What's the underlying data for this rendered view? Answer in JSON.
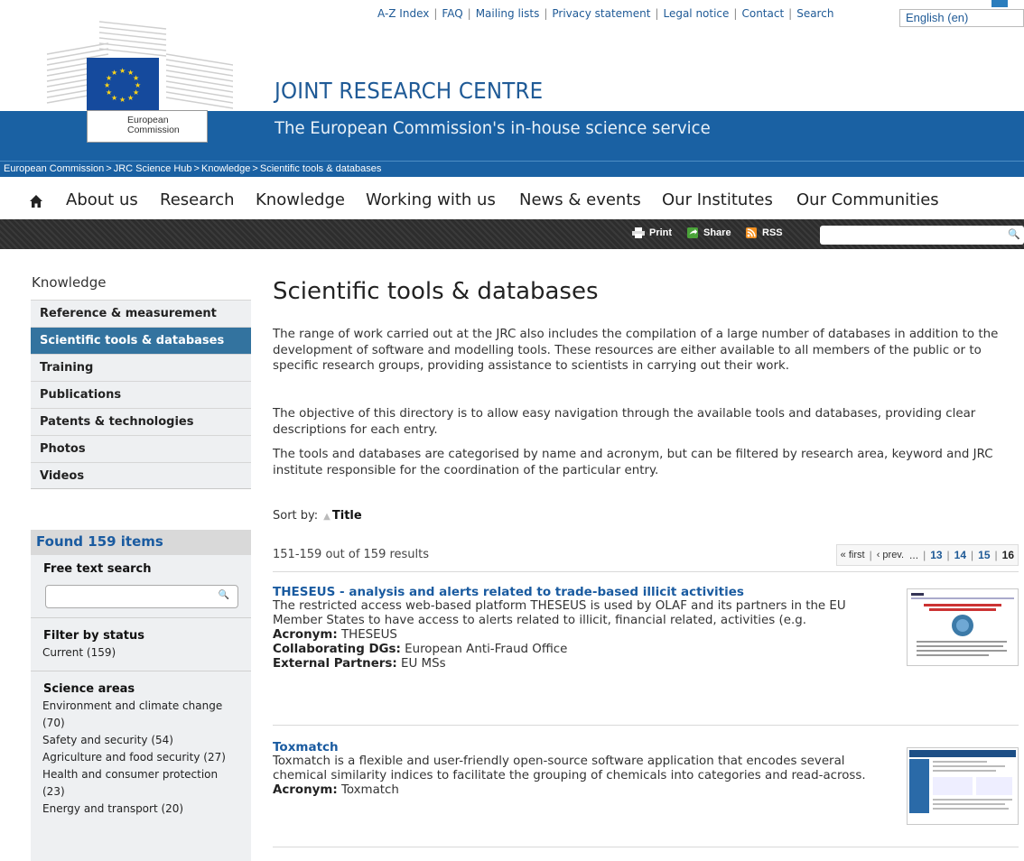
{
  "top_links": [
    "A-Z Index",
    "FAQ",
    "Mailing lists",
    "Privacy statement",
    "Legal notice",
    "Contact",
    "Search"
  ],
  "language": "English (en)",
  "header": {
    "logo_text_line1": "European",
    "logo_text_line2": "Commission",
    "title": "JOINT RESEARCH CENTRE",
    "subtitle": "The European Commission's in-house science service"
  },
  "breadcrumb": [
    "European Commission",
    "JRC Science Hub",
    "Knowledge",
    "Scientific tools & databases"
  ],
  "nav": [
    "About us",
    "Research",
    "Knowledge",
    "Working with us",
    "News & events",
    "Our Institutes",
    "Our Communities"
  ],
  "toolbar": {
    "print": "Print",
    "share": "Share",
    "rss": "RSS"
  },
  "sidebar": {
    "heading": "Knowledge",
    "items": [
      {
        "label": "Reference & measurement"
      },
      {
        "label": "Scientific tools & databases",
        "active": true
      },
      {
        "label": "Training"
      },
      {
        "label": "Publications"
      },
      {
        "label": "Patents & technologies"
      },
      {
        "label": "Photos"
      },
      {
        "label": "Videos"
      }
    ]
  },
  "filters": {
    "found": "Found 159 items",
    "free_text_heading": "Free text search",
    "status_heading": "Filter by status",
    "status_options": [
      "Current (159)"
    ],
    "science_heading": "Science areas",
    "science_options": [
      "Environment and climate change (70)",
      "Safety and security (54)",
      "Agriculture and food security (27)",
      "Health and consumer protection (23)",
      "Energy and transport (20)"
    ]
  },
  "main": {
    "title": "Scientific tools & databases",
    "paragraphs": [
      "The range of work carried out at the JRC also includes the compilation of a large number of databases in addition to the development of software and modelling tools. These resources are either available to all members of the public or to specific research groups, providing assistance to scientists in carrying out their work.",
      "The objective of this directory is to allow easy navigation through the available tools and databases, providing clear descriptions for each entry.",
      "The tools and databases are categorised by name and acronym, but can be filtered by research area, keyword and JRC institute responsible for the coordination of the particular entry."
    ],
    "sort_label": "Sort by:",
    "sort_value": "Title",
    "results_count": "151-159 out of 159 results",
    "pager": {
      "first": "« first",
      "prev": "‹ prev.",
      "ellipsis": "...",
      "pages": [
        "13",
        "14",
        "15",
        "16"
      ]
    },
    "entries": [
      {
        "title": "THESEUS - analysis and alerts related to trade-based illicit activities",
        "description": "The restricted access web-based platform THESEUS is used by OLAF and its partners in the EU Member States to have access to alerts related to illicit, financial related, activities (e.g.",
        "meta": [
          {
            "label": "Acronym:",
            "value": "THESEUS"
          },
          {
            "label": "Collaborating DGs:",
            "value": "European Anti-Fraud Office"
          },
          {
            "label": "External Partners:",
            "value": "EU MSs"
          }
        ]
      },
      {
        "title": "Toxmatch",
        "description": "Toxmatch is a flexible and user-friendly open-source software application that encodes several chemical similarity indices to facilitate the grouping of chemicals into categories and read-across.",
        "meta": [
          {
            "label": "Acronym:",
            "value": "Toxmatch"
          }
        ]
      }
    ]
  }
}
